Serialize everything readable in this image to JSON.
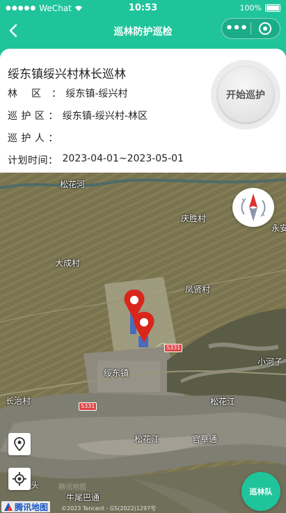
{
  "status_bar": {
    "carrier": "WeChat",
    "time": "10:53",
    "battery": "100%"
  },
  "nav": {
    "title": "巡林防护巡检",
    "more_icon": "more-dots-icon",
    "close_icon": "mini-program-close-icon"
  },
  "patrol": {
    "title": "绥东镇绥兴村林长巡林",
    "forest_area_label": "林　 区　：",
    "forest_area_value": "绥东镇-绥兴村",
    "patrol_area_label": "巡 护 区 ：",
    "patrol_area_value": "绥东镇-绥兴村-林区",
    "patroller_label": "巡 护 人 ：",
    "patroller_value": "",
    "plan_time_label": "计划时间：",
    "plan_time_value": "2023-04-01~2023-05-01",
    "start_button": "开始巡护"
  },
  "map": {
    "places": {
      "river_top": "松花河",
      "qingsheng": "庆胜村",
      "yongan": "永安",
      "dacheng": "大成村",
      "fengxian": "凤贤村",
      "suidong": "绥东镇",
      "xiaohezi": "小河子",
      "changzhi": "长治村",
      "songhuajiang_1": "松花江",
      "songhuajiang_2": "松花江",
      "guancaotong": "官草通",
      "niuweibatong": "牛尾巴通",
      "tou": "头"
    },
    "road_badges": [
      "S331",
      "S331"
    ],
    "logo": "腾讯地图",
    "watermark": "腾讯地图",
    "copyright": "©2023 Tencent - GS(2022)1297号",
    "team_button": "巡林队",
    "colors": {
      "accent": "#1fc49b",
      "marker": "#d8261c"
    }
  }
}
